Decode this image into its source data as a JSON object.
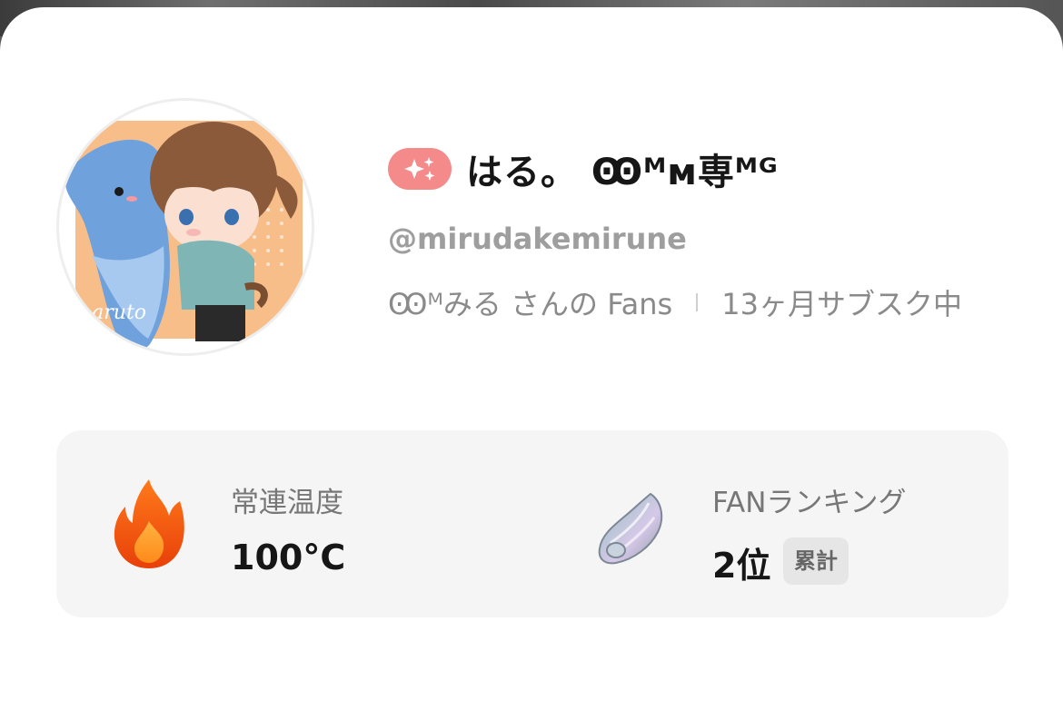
{
  "profile": {
    "display_name": "はる。 Ꙭᴹᴍ専ᴹᴳ",
    "handle": "@mirudakemirune",
    "fan_of": "Ꙭᴹみる さんの Fans",
    "subscription": "13ヶ月サブスク中",
    "avatar_signature": "haruto"
  },
  "badges": {
    "sparkle_icon": "sparkles-icon",
    "sparkle_color": "#f58a8a"
  },
  "stats": {
    "regular_temp": {
      "label": "常連温度",
      "value": "100°C",
      "icon": "flame-icon"
    },
    "fan_ranking": {
      "label": "FANランキング",
      "value": "2位",
      "badge": "累計",
      "icon": "silver-wing-icon"
    }
  },
  "colors": {
    "sheet_bg": "#ffffff",
    "card_bg": "#f5f5f5",
    "primary_text": "#161616",
    "secondary_text": "#9e9e9e",
    "flame": "#f25a0f"
  }
}
